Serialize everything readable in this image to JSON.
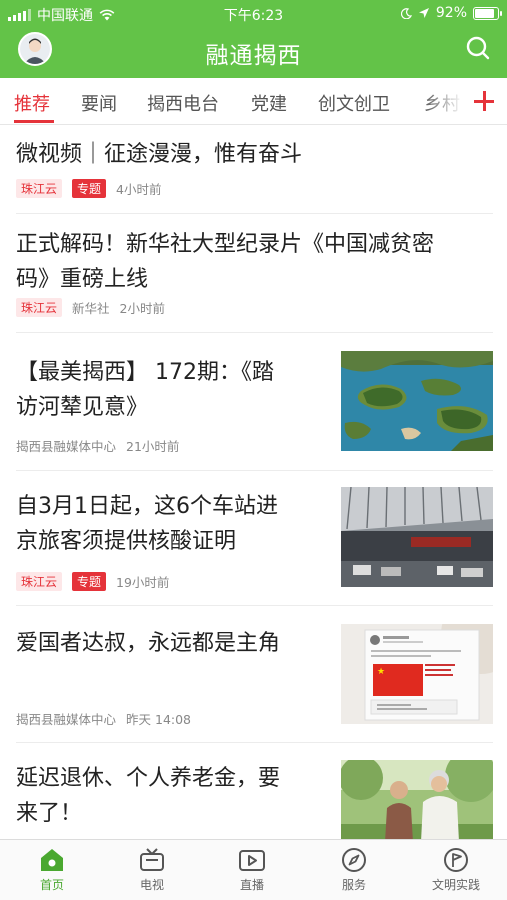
{
  "status_bar": {
    "carrier": "中国联通",
    "time": "下午6:23",
    "battery": "92%"
  },
  "header": {
    "title": "融通揭西"
  },
  "tabs": [
    "推荐",
    "要闻",
    "揭西电台",
    "党建",
    "创文创卫",
    "乡村"
  ],
  "feed": [
    {
      "title_lines": [
        "微视频｜征途漫漫，惟有奋斗"
      ],
      "source": "珠江云",
      "topic": "专题",
      "time": "4小时前"
    },
    {
      "title_lines": [
        "正式解码！新华社大型纪录片《中国减贫密",
        "码》重磅上线"
      ],
      "source": "珠江云",
      "publisher": "新华社",
      "time": "2小时前"
    },
    {
      "title_lines": [
        "【最美揭西】 172期：《踏",
        "访河辇见意》"
      ],
      "publisher": "揭西县融媒体中心",
      "time": "21小时前",
      "thumb": "lake-islands-aerial"
    },
    {
      "title_lines": [
        "自3月1日起，这6个车站进",
        "京旅客须提供核酸证明"
      ],
      "source": "珠江云",
      "topic": "专题",
      "time": "19小时前",
      "thumb": "train-station-plaza"
    },
    {
      "title_lines": [
        "爱国者达叔，永远都是主角"
      ],
      "publisher": "揭西县融媒体中心",
      "time": "昨天 14:08",
      "thumb": "social-post-china-flag"
    },
    {
      "title_lines": [
        "延迟退休、个人养老金，要",
        "来了！"
      ],
      "thumb": "elderly-couple-walking"
    }
  ],
  "bottom_nav": [
    {
      "label": "首页",
      "icon": "home-icon",
      "active": true
    },
    {
      "label": "电视",
      "icon": "tv-icon"
    },
    {
      "label": "直播",
      "icon": "live-video-icon"
    },
    {
      "label": "服务",
      "icon": "compass-icon"
    },
    {
      "label": "文明实践",
      "icon": "flag-badge-icon"
    }
  ],
  "colors": {
    "brand_green": "#63c348",
    "accent_red": "#e5333a",
    "nav_active": "#4aa830"
  }
}
